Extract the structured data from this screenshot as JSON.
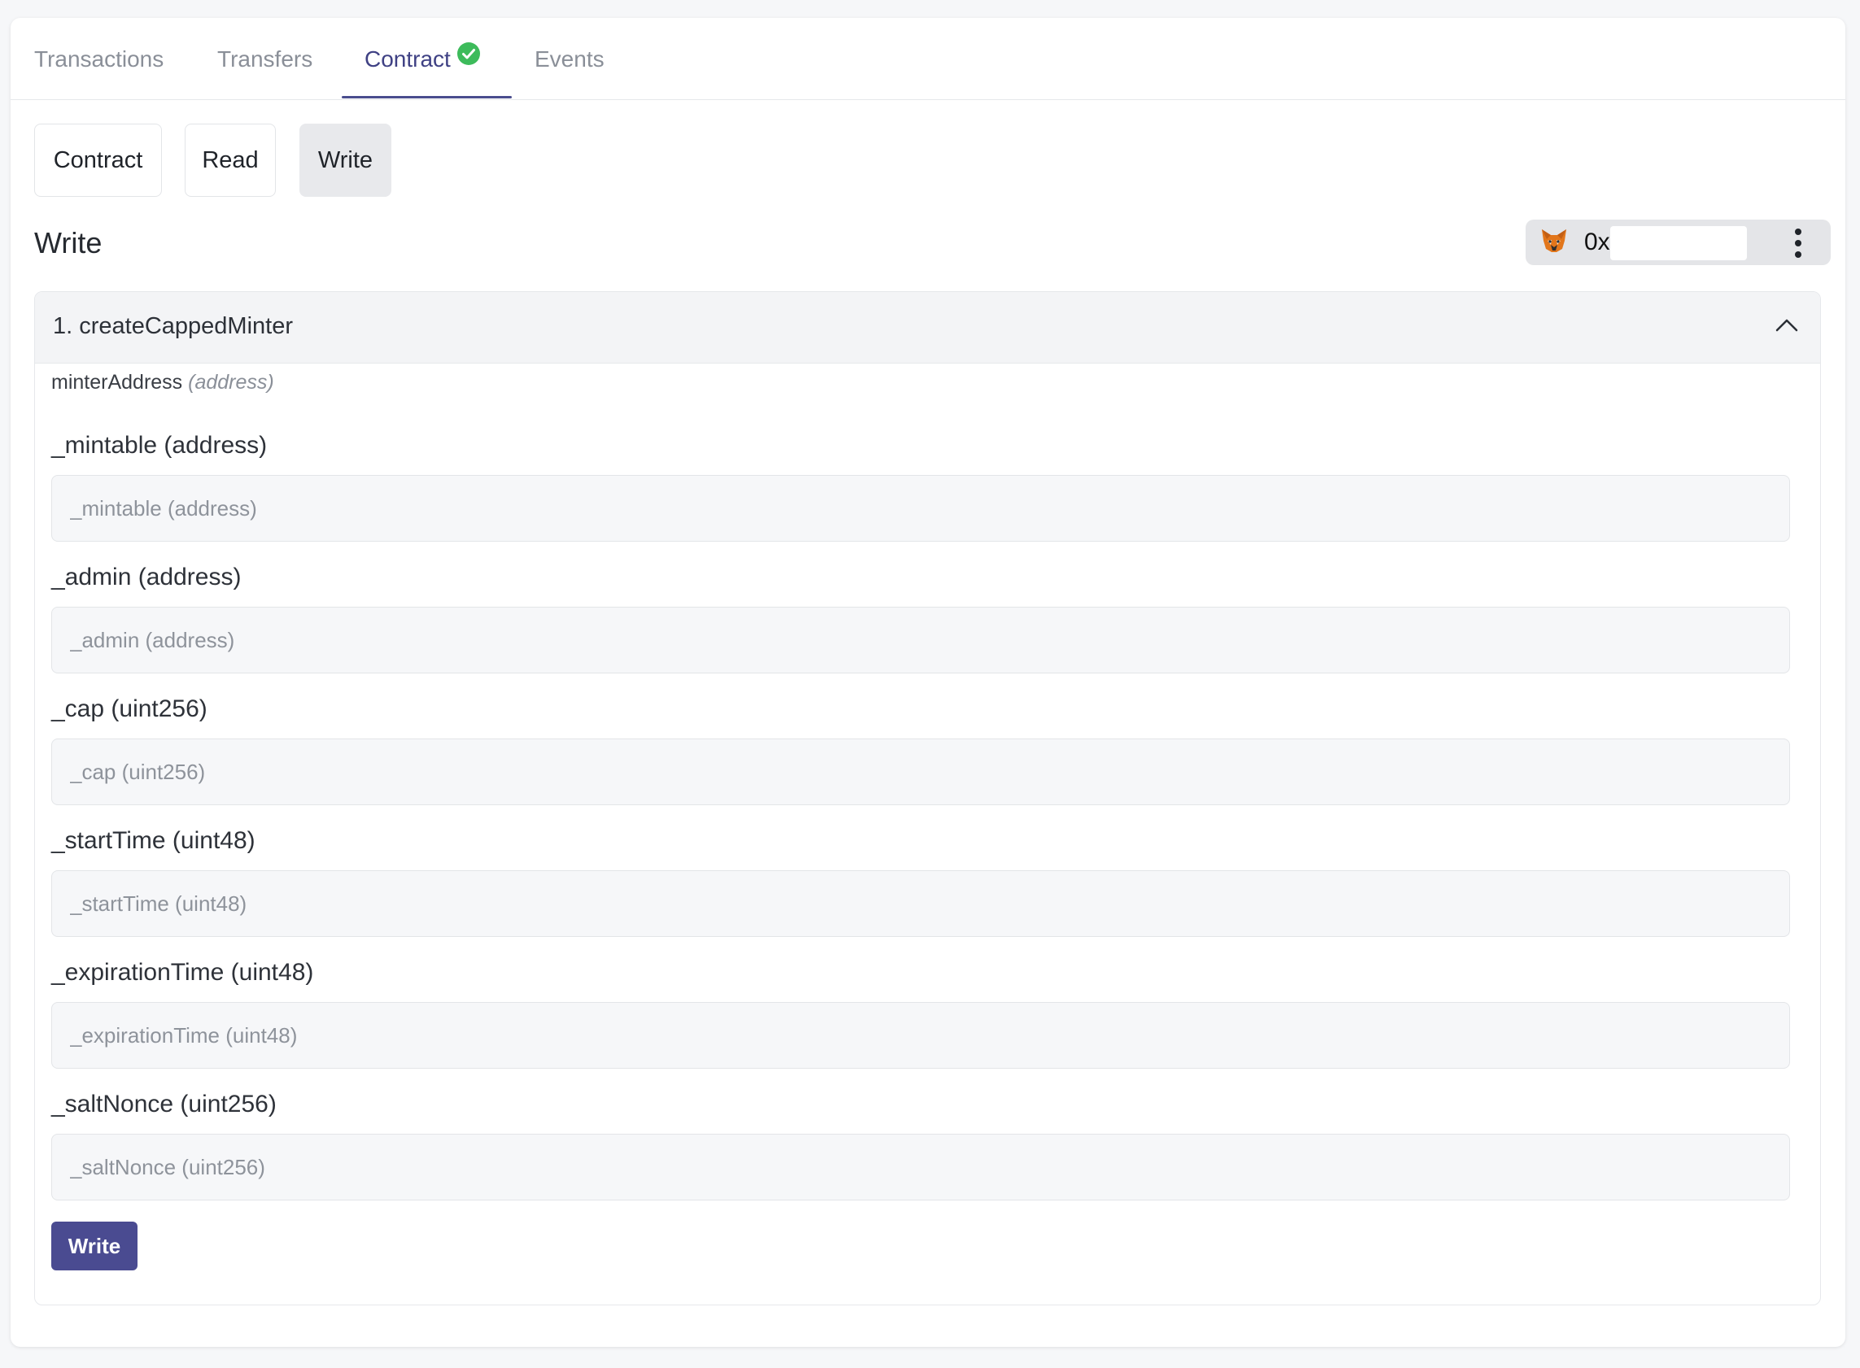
{
  "tabs": [
    {
      "label": "Transactions",
      "active": false
    },
    {
      "label": "Transfers",
      "active": false
    },
    {
      "label": "Contract",
      "active": true,
      "verified_icon": "check-circle-icon"
    },
    {
      "label": "Events",
      "active": false
    }
  ],
  "subtabs": [
    {
      "label": "Contract",
      "active": false
    },
    {
      "label": "Read",
      "active": false
    },
    {
      "label": "Write",
      "active": true
    }
  ],
  "section_title": "Write",
  "wallet": {
    "icon": "metamask-fox-icon",
    "address_prefix": "0x",
    "menu_icon": "kebab-menu-icon"
  },
  "method": {
    "title": "1. createCappedMinter",
    "expanded": true,
    "return_label": "minterAddress",
    "return_type": "(address)",
    "fields": [
      {
        "label": "_mintable (address)",
        "placeholder": "_mintable (address)",
        "value": ""
      },
      {
        "label": "_admin (address)",
        "placeholder": "_admin (address)",
        "value": ""
      },
      {
        "label": "_cap (uint256)",
        "placeholder": "_cap (uint256)",
        "value": ""
      },
      {
        "label": "_startTime (uint48)",
        "placeholder": "_startTime (uint48)",
        "value": ""
      },
      {
        "label": "_expirationTime (uint48)",
        "placeholder": "_expirationTime (uint48)",
        "value": ""
      },
      {
        "label": "_saltNonce (uint256)",
        "placeholder": "_saltNonce (uint256)",
        "value": ""
      }
    ],
    "submit_label": "Write"
  },
  "colors": {
    "accent": "#4a4b91",
    "verified": "#3dbb5b",
    "active_tab": "#3f4184"
  }
}
